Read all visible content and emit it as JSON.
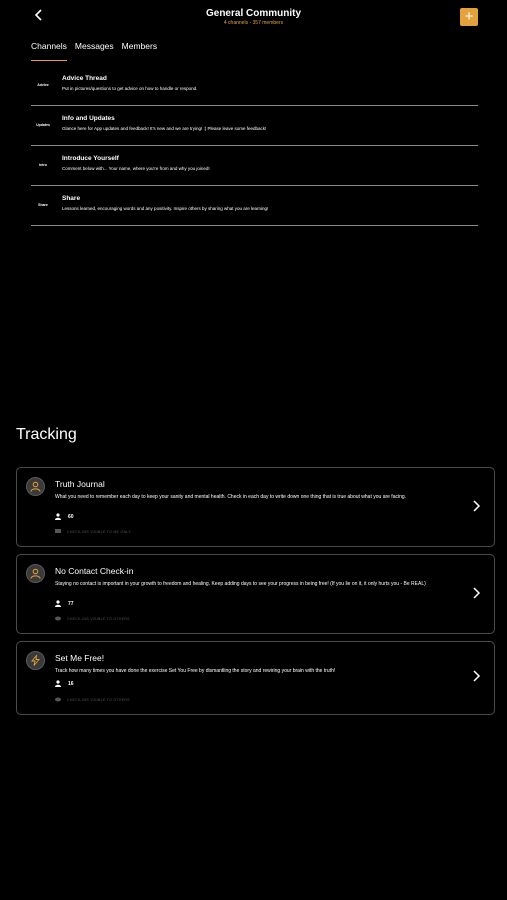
{
  "header": {
    "title": "General Community",
    "subtitle": "4 channels - 357 members",
    "back_icon": "chevron-left-icon",
    "add_icon": "plus-icon",
    "accent": "#e3a23c"
  },
  "tabs": [
    {
      "label": "Channels",
      "active": true
    },
    {
      "label": "Messages",
      "active": false
    },
    {
      "label": "Members",
      "active": false
    }
  ],
  "channels": [
    {
      "code": "Advice",
      "title": "Advice Thread",
      "description": "Put in pictures/questions to get advice on how to handle or respond."
    },
    {
      "code": "Updates",
      "title": "Info and Updates",
      "description": "Glance here for App updates and feedback! It's new and we are trying! :) Please leave some feedback!"
    },
    {
      "code": "Intro",
      "title": "Introduce Yourself",
      "description": "Comment below with... Your name, where you're from and why you joined!"
    },
    {
      "code": "Share",
      "title": "Share",
      "description": "Lessons learned, encouraging words and any positivity. Inspire others by sharing what you are learning!"
    }
  ],
  "tracking": {
    "title": "Tracking",
    "items": [
      {
        "title": "Truth Journal",
        "description": "What you need to remember each day to keep your sanity and mental health. Check in each day to write down one thing that is true about what you are facing.",
        "count": "60",
        "visibility": "CHECK-INS VISIBLE TO ME ONLY",
        "icon": "person-icon"
      },
      {
        "title": "No Contact Check-in",
        "description": "Staying no contact is important in your growth to freedom and healing. Keep adding days to see your progress in being free! (If you lie on it, it only hurts you - Be REAL)",
        "count": "77",
        "visibility": "CHECK-INS VISIBLE TO OTHERS",
        "icon": "person-icon"
      },
      {
        "title": "Set Me Free!",
        "description": "Track how many times you have done the exercise Set You Free by dismantling the story and rewiring your brain with the truth!",
        "count": "16",
        "visibility": "CHECK-INS VISIBLE TO OTHERS",
        "icon": "lightning-icon"
      }
    ]
  }
}
